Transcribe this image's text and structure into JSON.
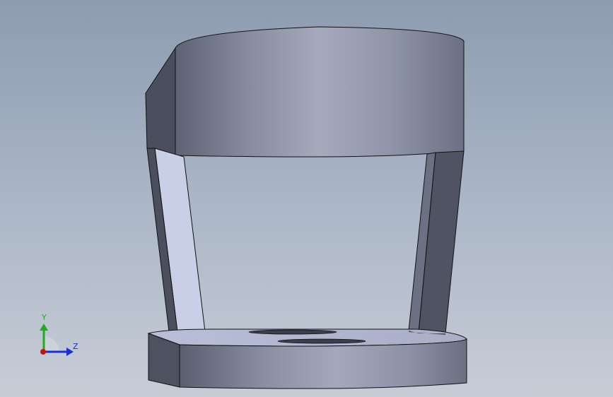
{
  "viewport": {
    "background_top": "#8d9cb1",
    "background_bottom": "#c7cdd7"
  },
  "model": {
    "part_color": "#8e94a7",
    "highlight_color": "#a6abbd",
    "shadow_color": "#4a4e5c",
    "inner_face_color": "#c9cfe6"
  },
  "triad": {
    "y_label": "Y",
    "z_label": "Z",
    "y_color": "#22aa22",
    "z_color": "#1a2fd0",
    "x_color": "#cc1111"
  }
}
